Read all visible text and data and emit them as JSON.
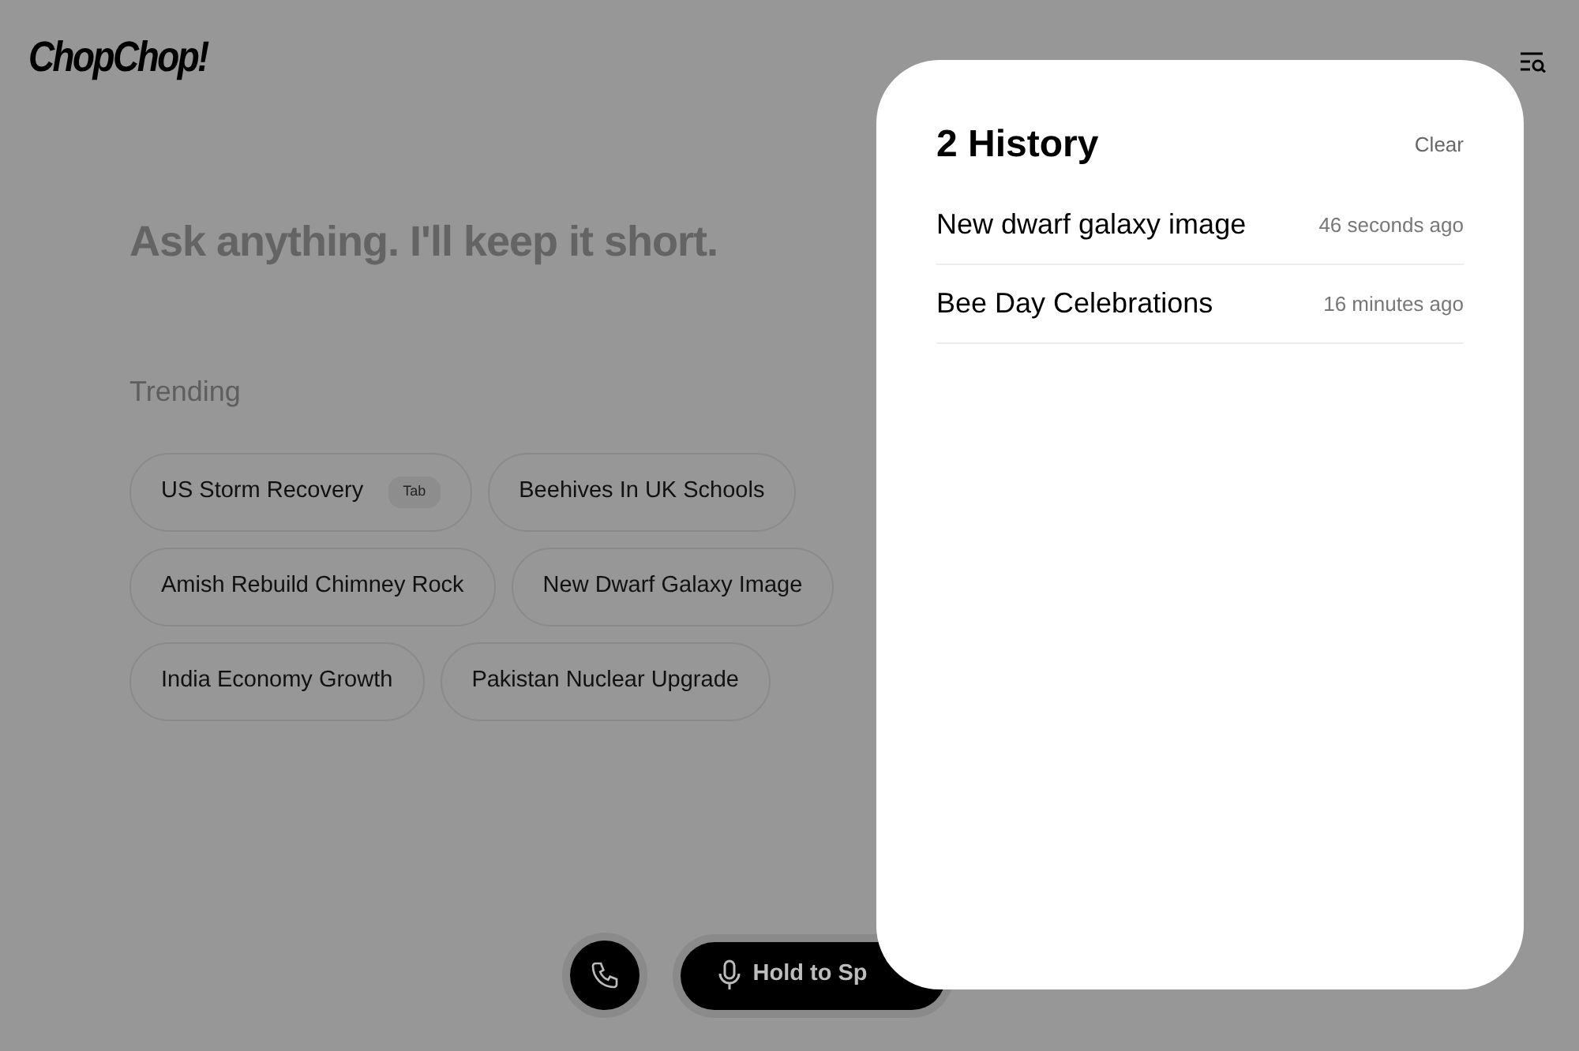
{
  "logo": "ChopChop!",
  "prompt": "Ask anything. I'll keep it short.",
  "trending": {
    "title": "Trending",
    "topics": [
      {
        "label": "US Storm Recovery",
        "shortcut": "Tab"
      },
      {
        "label": "Beehives In UK Schools"
      },
      {
        "label": "Amish Rebuild Chimney Rock"
      },
      {
        "label": "New Dwarf Galaxy Image"
      },
      {
        "label": "India Economy Growth"
      },
      {
        "label": "Pakistan Nuclear Upgrade"
      }
    ]
  },
  "speak_button": {
    "label": "Hold to Sp"
  },
  "history": {
    "title": "2 History",
    "clear": "Clear",
    "items": [
      {
        "title": "New dwarf galaxy image",
        "time": "46 seconds ago"
      },
      {
        "title": "Bee Day Celebrations",
        "time": "16 minutes ago"
      }
    ]
  }
}
